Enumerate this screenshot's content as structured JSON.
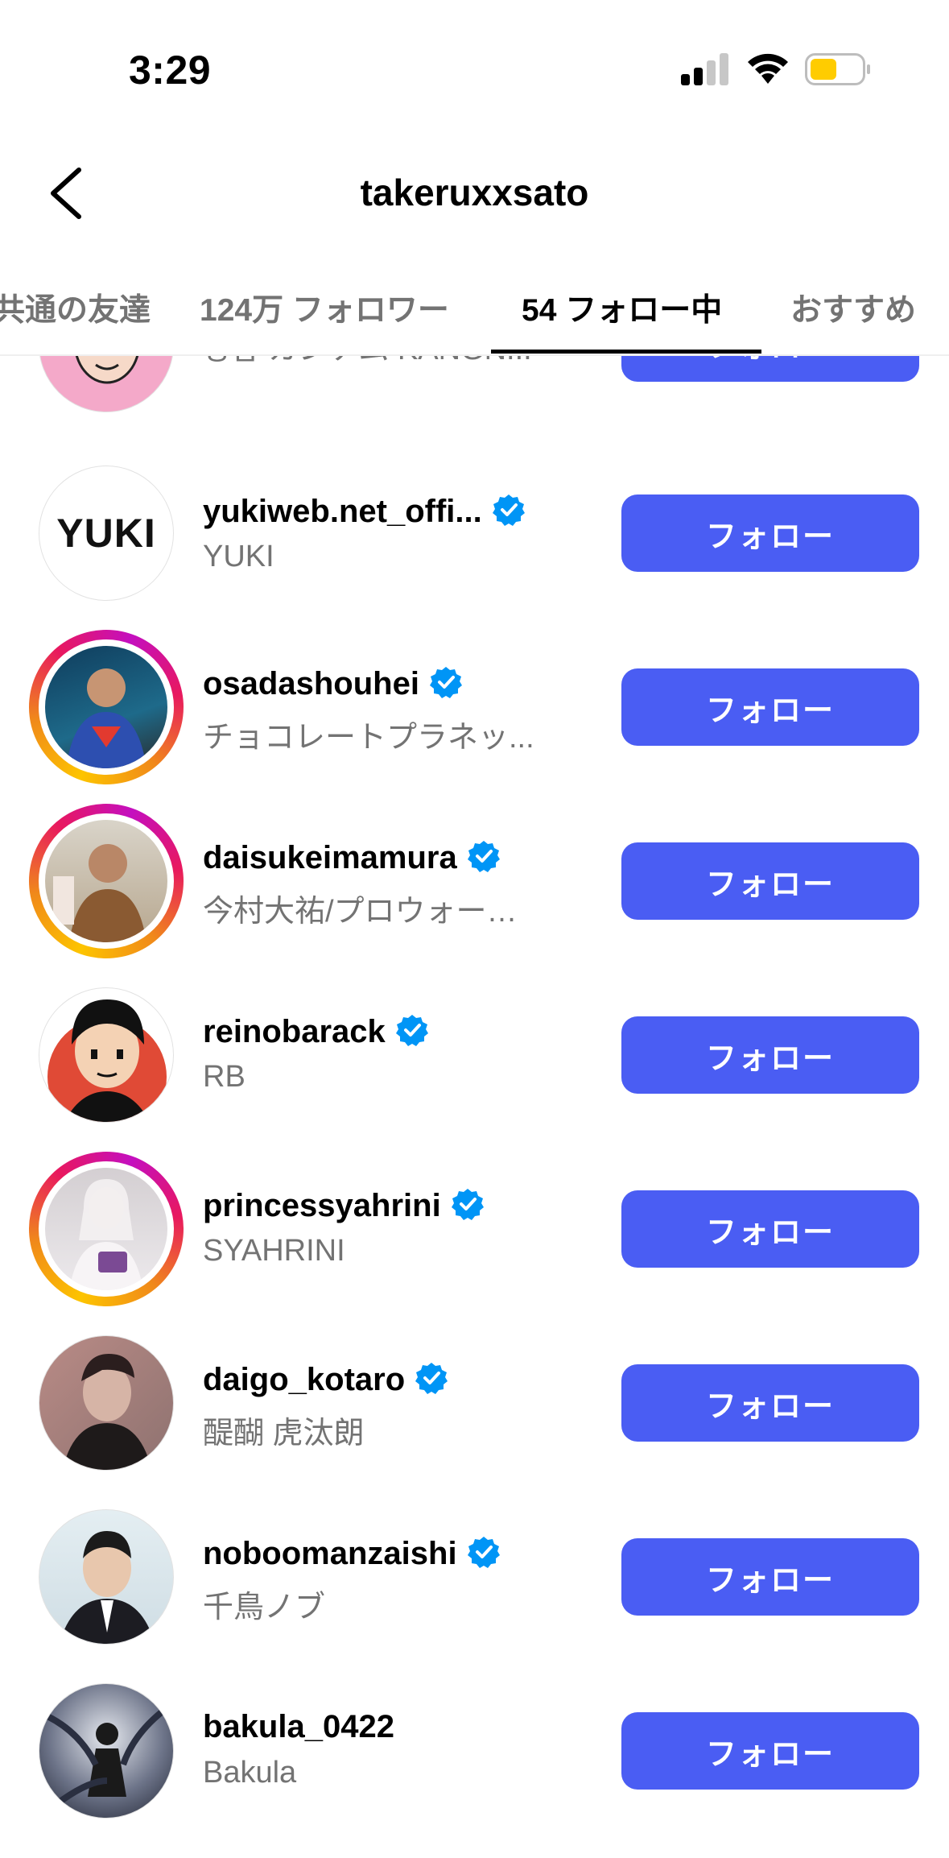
{
  "status_bar": {
    "time": "3:29"
  },
  "header": {
    "title": "takeruxxsato"
  },
  "tabs": [
    {
      "label": "共通の友達"
    },
    {
      "label": "124万 フォロワー"
    },
    {
      "label": "54 フォロー中"
    },
    {
      "label": "おすすめ"
    }
  ],
  "accounts": [
    {
      "username": "",
      "full_name": "강남 カンナム KANGN...",
      "verified": true,
      "button": "フォロー"
    },
    {
      "username": "yukiweb.net_offi...",
      "full_name": "YUKI",
      "verified": true,
      "button": "フォロー",
      "avatar_text": "YUKI"
    },
    {
      "username": "osadashouhei",
      "full_name": "チョコレートプラネッ...",
      "verified": true,
      "button": "フォロー"
    },
    {
      "username": "daisukeimamura",
      "full_name": "今村大祐/プロウォー…",
      "verified": true,
      "button": "フォロー"
    },
    {
      "username": "reinobarack",
      "full_name": "RB",
      "verified": true,
      "button": "フォロー"
    },
    {
      "username": "princessyahrini",
      "full_name": "SYAHRINI",
      "verified": true,
      "button": "フォロー"
    },
    {
      "username": "daigo_kotaro",
      "full_name": "醍醐 虎汰朗",
      "verified": true,
      "button": "フォロー"
    },
    {
      "username": "noboomanzaishi",
      "full_name": "千鳥ノブ",
      "verified": true,
      "button": "フォロー"
    },
    {
      "username": "bakula_0422",
      "full_name": "Bakula",
      "verified": false,
      "button": "フォロー"
    }
  ],
  "colors": {
    "follow_button": "#4a5df3",
    "verified_badge": "#0095f6",
    "secondary_text": "#737373"
  }
}
